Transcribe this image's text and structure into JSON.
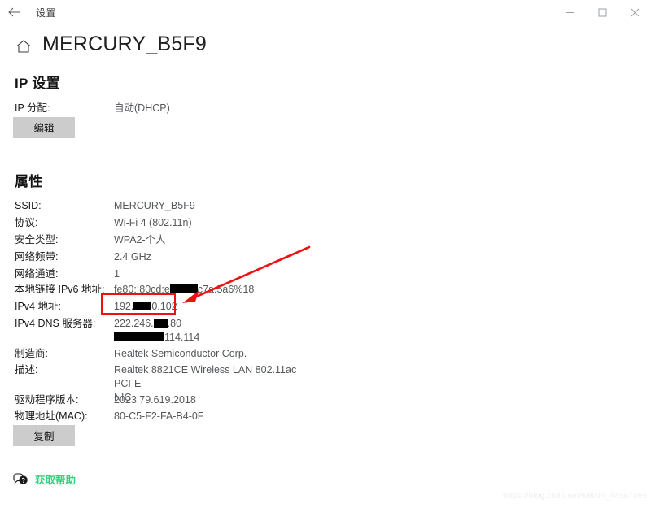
{
  "titlebar": {
    "back_icon": "back-arrow-icon",
    "title": "设置",
    "minimize_label": "最小化",
    "maximize_label": "最大化",
    "close_label": "关闭"
  },
  "header": {
    "home_icon": "home-icon",
    "title": "MERCURY_B5F9"
  },
  "ip_settings": {
    "heading": "IP 设置",
    "assignment_label": "IP 分配:",
    "assignment_value": "自动(DHCP)",
    "edit_button": "编辑"
  },
  "properties": {
    "heading": "属性",
    "rows": [
      {
        "label": "SSID:",
        "value": "MERCURY_B5F9"
      },
      {
        "label": "协议:",
        "value": "Wi-Fi 4 (802.11n)"
      },
      {
        "label": "安全类型:",
        "value": "WPA2-个人"
      },
      {
        "label": "网络频带:",
        "value": "2.4 GHz"
      },
      {
        "label": "网络通道:",
        "value": "1"
      },
      {
        "label": "本地链接 IPv6 地址:",
        "value_prefix": "fe80::80cd:e",
        "value_suffix": "c7a:5a6%18",
        "redacted": true
      },
      {
        "label": "IPv4 地址:",
        "value_prefix": "192.",
        "value_suffix": "0.102",
        "redacted": true
      },
      {
        "label": "IPv4 DNS 服务器:",
        "value_prefix": "222.246.",
        "value_suffix": ".80",
        "value_line2_suffix": "114.114",
        "redacted": true
      },
      {
        "label": "制造商:",
        "value": "Realtek Semiconductor Corp."
      },
      {
        "label": "描述:",
        "value": "Realtek 8821CE Wireless LAN 802.11ac PCI-E",
        "value_line2": "NIC"
      },
      {
        "label": "驱动程序版本:",
        "value": "2023.79.619.2018"
      },
      {
        "label": "物理地址(MAC):",
        "value": "80-C5-F2-FA-B4-0F"
      }
    ],
    "copy_button": "复制"
  },
  "footer": {
    "help_icon": "help-chat-icon",
    "help_text": "获取帮助",
    "help_color": "#32d17e"
  },
  "annotations": {
    "highlight_color": "#ee1111",
    "rect_target": "IPv4 地址",
    "arrow_from": "380,305",
    "arrow_to": "224,372"
  },
  "watermark": {
    "text": "https://blog.csdn.net/weixin_44567065"
  }
}
